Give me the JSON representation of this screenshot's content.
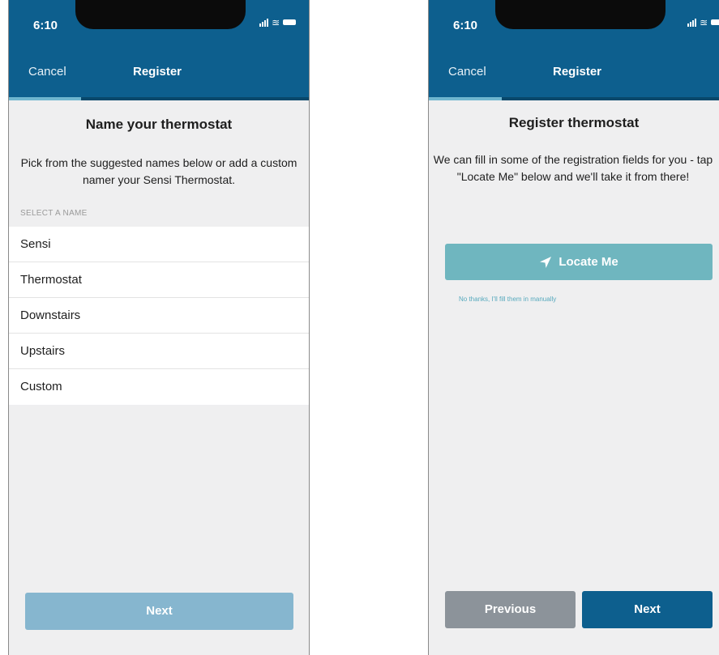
{
  "left_screen": {
    "status": {
      "time": "6:10"
    },
    "nav": {
      "cancel": "Cancel",
      "title": "Register",
      "progress": 0.24
    },
    "title": "Name your thermostat",
    "description": "Pick from the suggested names below or add a custom namer your Sensi Thermostat.",
    "section_label": "SELECT A NAME",
    "names": [
      "Sensi",
      "Thermostat",
      "Downstairs",
      "Upstairs",
      "Custom"
    ],
    "next_label": "Next"
  },
  "right_screen": {
    "status": {
      "time": "6:10"
    },
    "nav": {
      "cancel": "Cancel",
      "title": "Register",
      "progress": 0.25
    },
    "title": "Register thermostat",
    "description": "We can fill in some of the registration fields for you - tap \"Locate Me\" below and we'll take it from there!",
    "locate_label": "Locate Me",
    "manual_link": "No thanks, I'll fill them in manually",
    "previous_label": "Previous",
    "next_label": "Next"
  },
  "colors": {
    "header": "#0d5f8e",
    "progress": "#6fb6cf",
    "next_disabled": "#86b6cf",
    "locate": "#6fb6bf",
    "previous": "#8c939a"
  },
  "icons": {
    "status": [
      "signal-icon",
      "wifi-icon",
      "battery-icon"
    ],
    "locate": "location-arrow-icon"
  }
}
